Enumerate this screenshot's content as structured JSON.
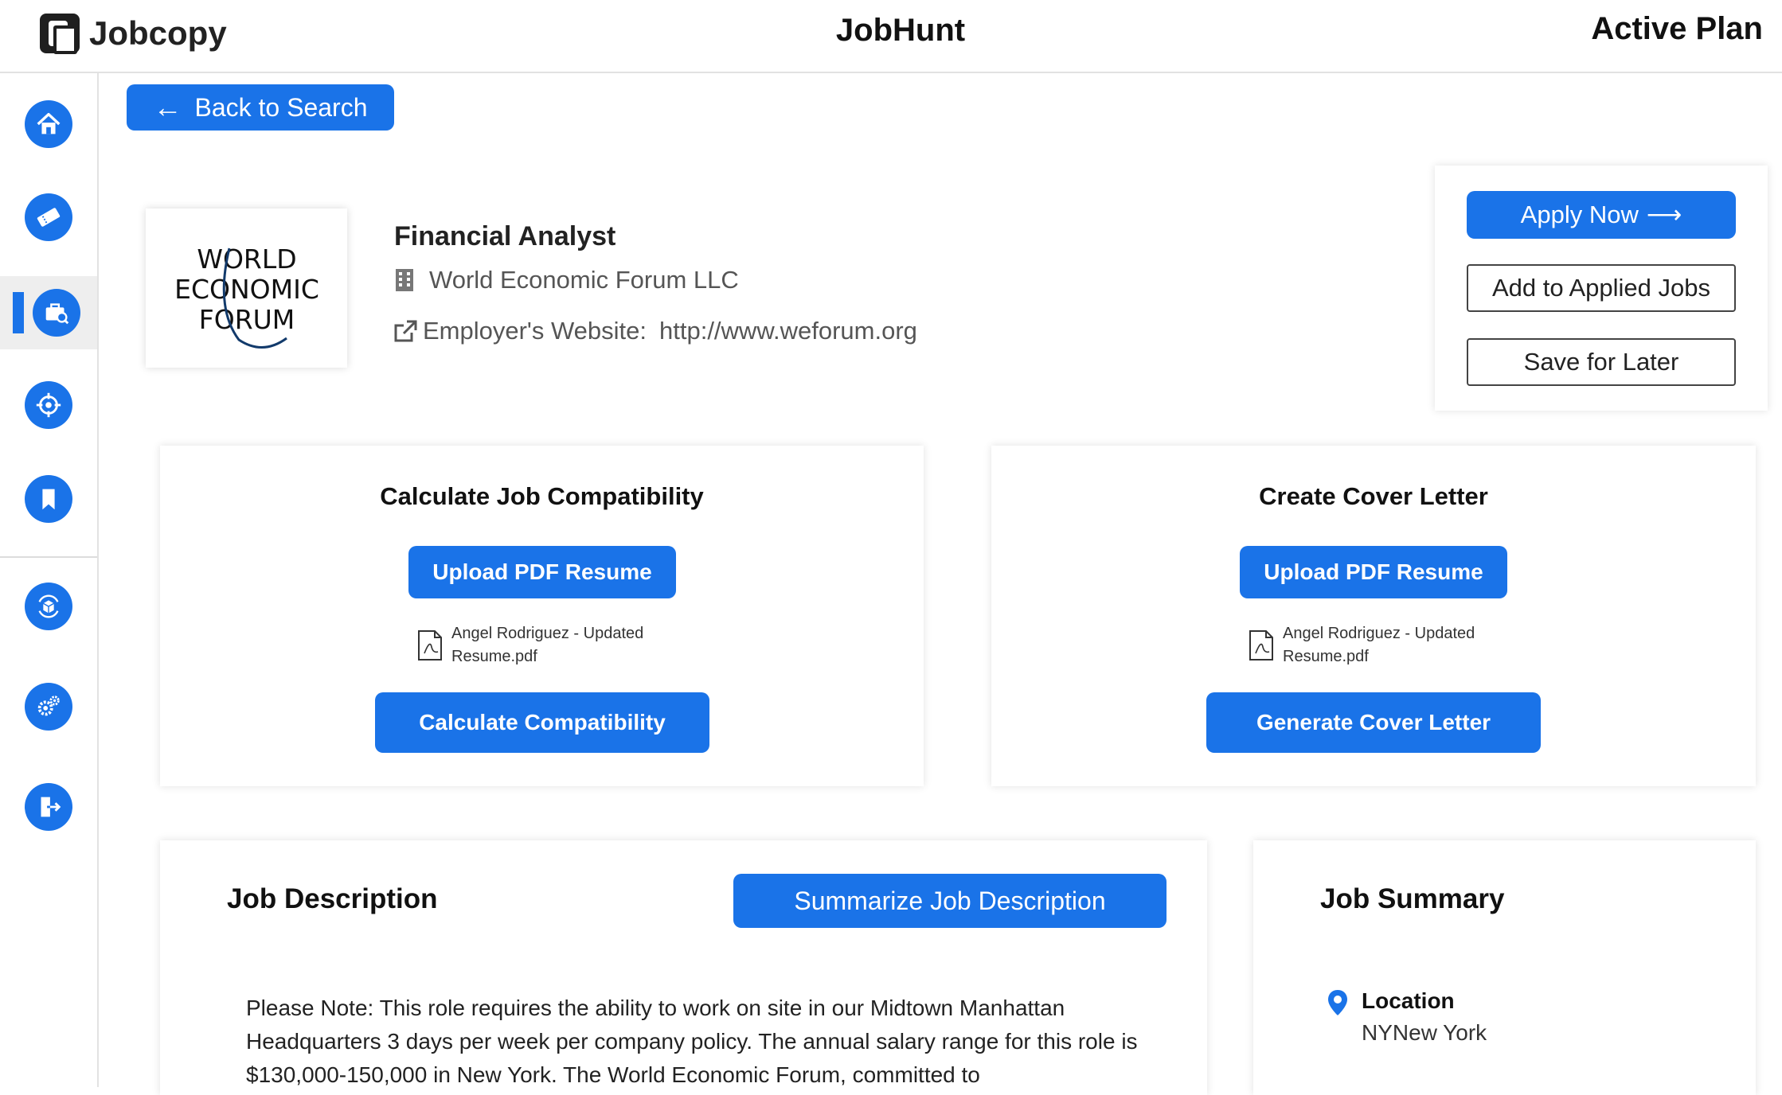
{
  "header": {
    "brand": "Jobcopy",
    "app_title": "JobHunt",
    "plan": "Active Plan"
  },
  "sidebar": {
    "items": [
      {
        "icon": "home-icon"
      },
      {
        "icon": "ticket-icon"
      },
      {
        "icon": "briefcase-search-icon",
        "active": true
      },
      {
        "icon": "target-icon"
      },
      {
        "icon": "bookmark-icon"
      },
      {
        "icon": "box-refresh-icon"
      },
      {
        "icon": "gears-icon"
      },
      {
        "icon": "logout-icon"
      }
    ],
    "accent": "#1a73e8"
  },
  "nav": {
    "back_label": "Back to Search"
  },
  "job": {
    "company_logo_text": [
      "WORLD",
      "ECONOMIC",
      "FORUM"
    ],
    "title": "Financial Analyst",
    "company": "World Economic Forum LLC",
    "website_label": "Employer's Website:",
    "website_url": "http://www.weforum.org"
  },
  "actions": {
    "apply_label": "Apply Now",
    "applied_label": "Add to Applied Jobs",
    "save_label": "Save for Later"
  },
  "compatibility": {
    "title": "Calculate Job Compatibility",
    "upload_label": "Upload PDF Resume",
    "file_name": "Angel Rodriguez - Updated Resume.pdf",
    "action_label": "Calculate Compatibility"
  },
  "cover_letter": {
    "title": "Create Cover Letter",
    "upload_label": "Upload PDF Resume",
    "file_name": "Angel Rodriguez - Updated Resume.pdf",
    "action_label": "Generate Cover Letter"
  },
  "description": {
    "title": "Job Description",
    "summarize_label": "Summarize Job Description",
    "text": "Please Note: This role requires the ability to work on site in our Midtown Manhattan Headquarters 3 days per week per company policy. The annual salary range for this role is $130,000-150,000 in New York. The World Economic Forum, committed to"
  },
  "summary": {
    "title": "Job Summary",
    "location_label": "Location",
    "location_value": "NYNew York"
  }
}
